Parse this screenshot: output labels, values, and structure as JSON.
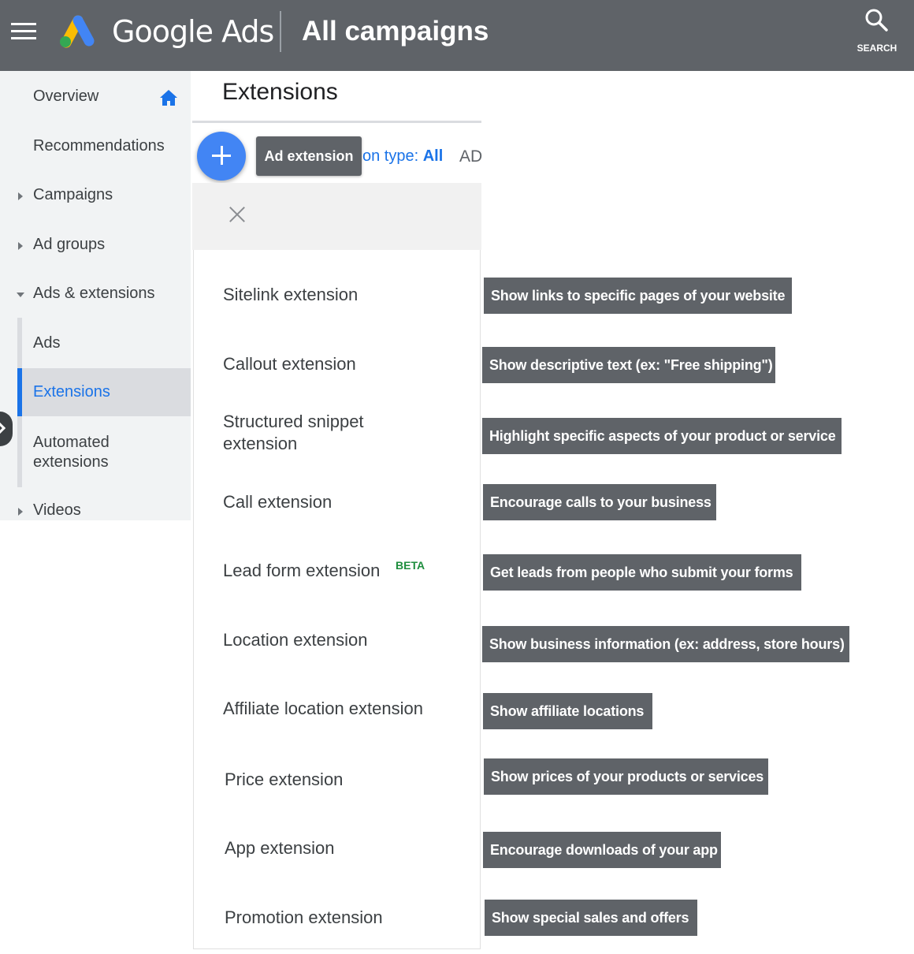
{
  "header": {
    "product_name": "Google Ads",
    "page_heading": "All campaigns",
    "search_label": "SEARCH"
  },
  "sidebar": {
    "items": [
      {
        "label": "Overview"
      },
      {
        "label": "Recommendations"
      },
      {
        "label": "Campaigns"
      },
      {
        "label": "Ad groups"
      },
      {
        "label": "Ads & extensions"
      },
      {
        "label": "Ads"
      },
      {
        "label": "Extensions"
      },
      {
        "label": "Automated extensions"
      },
      {
        "label": "Videos"
      }
    ],
    "active_item": "Extensions"
  },
  "main": {
    "title": "Extensions",
    "fab_tooltip": "Ad extension",
    "filter_prefix": "on type: ",
    "filter_value": "All",
    "column_fragment": "AD"
  },
  "extensions": [
    {
      "label": "Sitelink extension",
      "description": "Show links to specific pages of your website"
    },
    {
      "label": "Callout extension",
      "description": "Show descriptive text (ex: \"Free shipping\")"
    },
    {
      "label": "Structured snippet extension",
      "description": "Highlight specific aspects of your product or service"
    },
    {
      "label": "Call extension",
      "description": "Encourage calls to your business"
    },
    {
      "label": "Lead form extension",
      "badge": "BETA",
      "description": "Get leads from people who submit your forms"
    },
    {
      "label": "Location extension",
      "description": "Show business information (ex: address, store hours)"
    },
    {
      "label": "Affiliate location extension",
      "description": "Show affiliate locations"
    },
    {
      "label": "Price extension",
      "description": "Show prices of your products or services"
    },
    {
      "label": "App extension",
      "description": "Encourage downloads of your app"
    },
    {
      "label": "Promotion extension",
      "description": "Show special sales and offers"
    }
  ],
  "colors": {
    "topbar": "#5f6368",
    "accent_blue": "#1a73e8",
    "fab_blue": "#4285f4",
    "beta_green": "#1e8e3e",
    "tag_gray": "#5f6368"
  },
  "icons": [
    "menu-icon",
    "google-ads-logo",
    "search-icon",
    "home-icon",
    "close-icon",
    "add-icon",
    "chevron-right-icon"
  ]
}
